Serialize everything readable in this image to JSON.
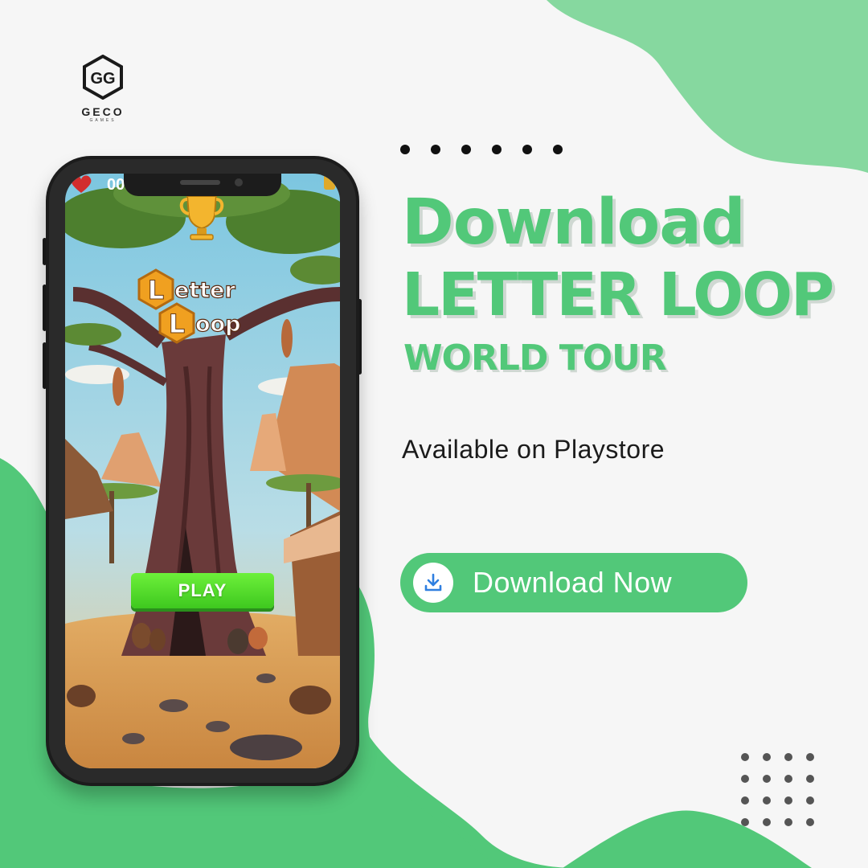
{
  "brand": {
    "name": "GECO",
    "sub": "GAMES"
  },
  "headline": {
    "line1": "Download",
    "line2": "LETTER LOOP",
    "line3": "WORLD TOUR"
  },
  "subtitle": "Available on Playstore",
  "cta": {
    "label": "Download Now",
    "icon": "download-icon"
  },
  "game": {
    "hud_count": "00",
    "title_word1": "etter",
    "title_letter1": "L",
    "title_word2": "oop",
    "title_letter2": "L",
    "play_label": "PLAY"
  },
  "colors": {
    "accent": "#52c879",
    "accent_light": "#86d89f",
    "background": "#f6f6f6",
    "play_green": "#4fdc2a"
  }
}
